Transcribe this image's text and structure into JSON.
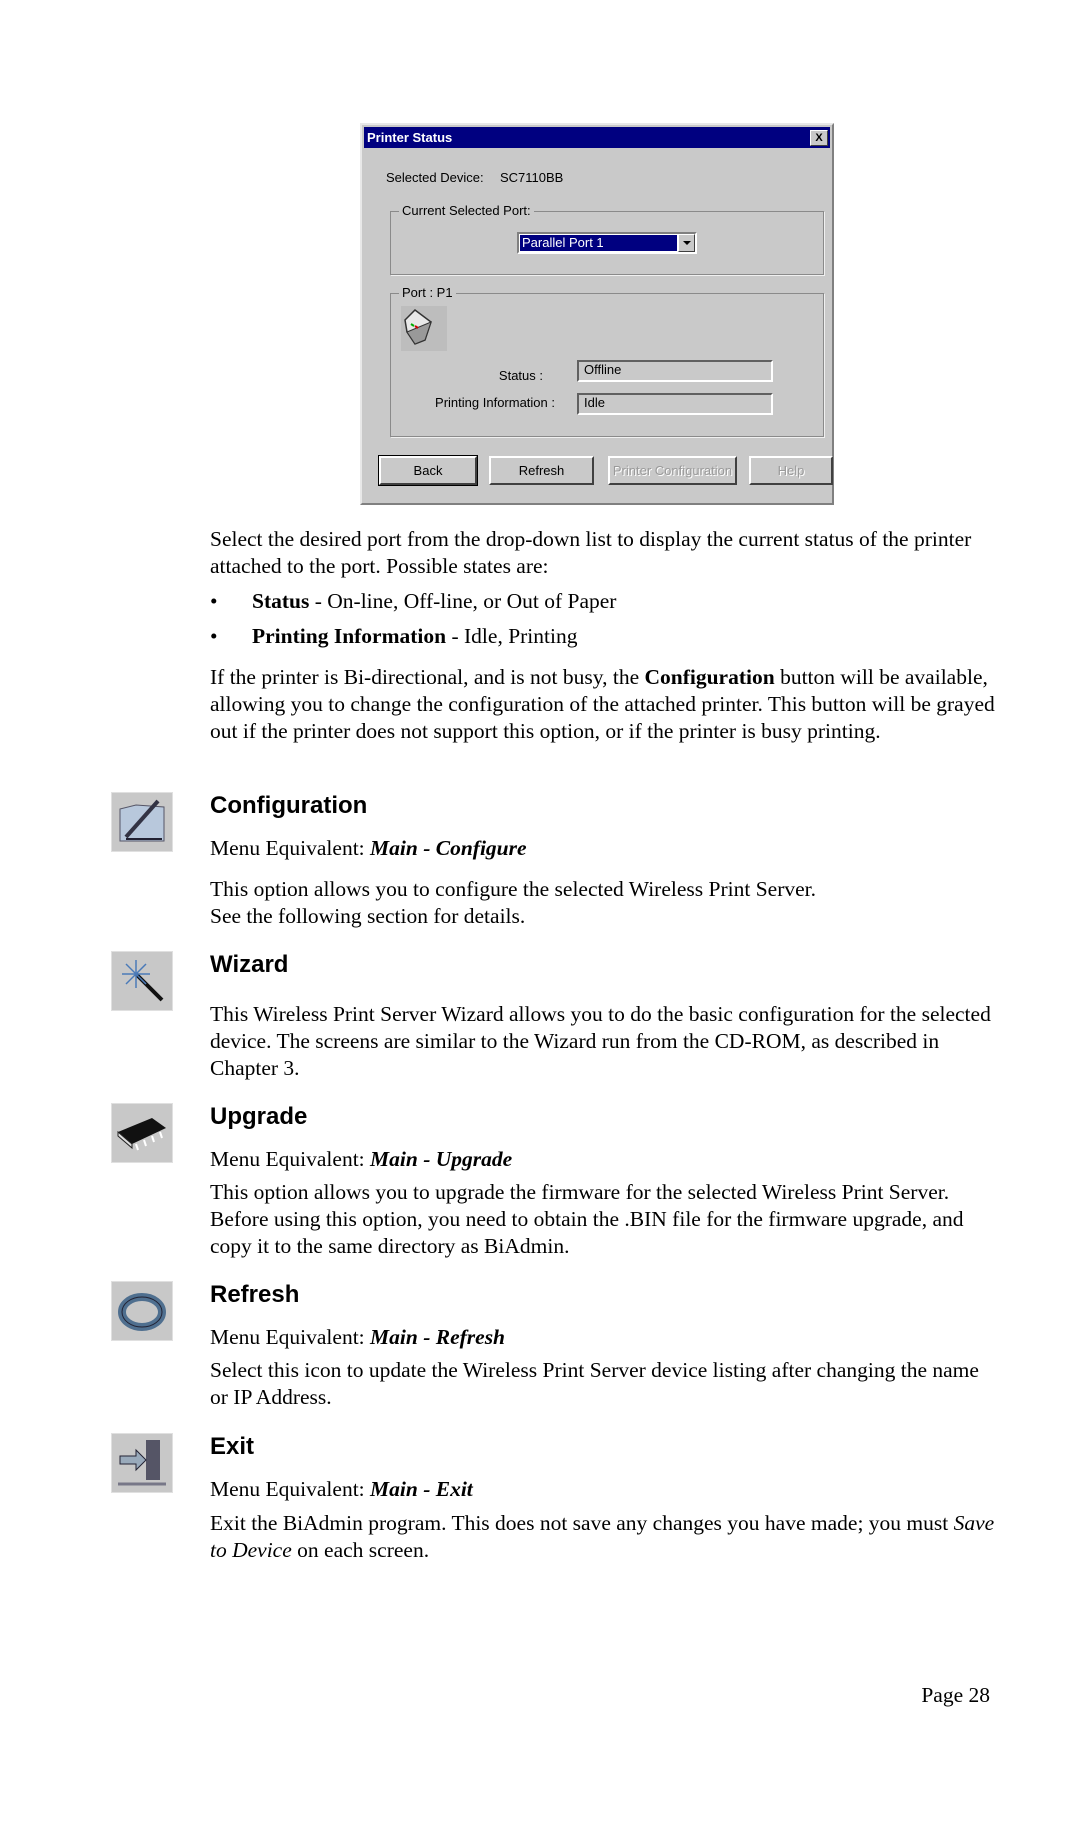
{
  "dialog": {
    "title": "Printer Status",
    "close_label": "X",
    "selected_device_label": "Selected Device:",
    "selected_device_value": "SC7110BB",
    "port_group_label": "Current Selected Port:",
    "port_dropdown_value": "Parallel Port 1",
    "port_info_group_label": "Port : P1",
    "status_label": "Status :",
    "status_value": "Offline",
    "printing_info_label": "Printing Information :",
    "printing_info_value": "Idle",
    "buttons": {
      "back": "Back",
      "refresh": "Refresh",
      "printer_configuration": "Printer Configuration",
      "help": "Help"
    }
  },
  "intro": {
    "para1": "Select the desired port from the drop-down list to display the current status of the printer attached to the port. Possible states are:",
    "bullets": [
      {
        "term": "Status",
        "text": " - On-line, Off-line, or Out of Paper"
      },
      {
        "term": "Printing Information",
        "text": " - Idle, Printing"
      }
    ],
    "para2_a": "If the printer is Bi-directional, and is not busy, the ",
    "para2_bold": "Configuration",
    "para2_b": " button will be available, allowing you to change the configuration of the attached printer. This button will be grayed out if the printer does not support this option, or if the printer is busy printing."
  },
  "sections": {
    "configuration": {
      "icon": "configure-pen-folder-icon",
      "title": "Configuration",
      "menu_prefix": "Menu Equivalent: ",
      "menu_path": "Main - Configure",
      "body_line1": "This option allows you to configure the selected Wireless Print Server.",
      "body_line2": "See the following section for details."
    },
    "wizard": {
      "icon": "magic-wand-icon",
      "title": "Wizard",
      "body": "This Wireless Print Server Wizard allows you to do the basic configuration for the selected device. The screens are similar to the Wizard run from the CD-ROM, as described in Chapter 3."
    },
    "upgrade": {
      "icon": "memory-chip-icon",
      "title": "Upgrade",
      "menu_prefix": "Menu Equivalent: ",
      "menu_path": "Main - Upgrade",
      "body": "This option allows you to upgrade the firmware for the selected Wireless Print Server. Before using this option, you need to obtain the .BIN file for the firmware upgrade, and copy it to the same directory as BiAdmin."
    },
    "refresh": {
      "icon": "refresh-arrows-icon",
      "title": "Refresh",
      "menu_prefix": "Menu Equivalent: ",
      "menu_path": "Main - Refresh",
      "body": "Select this icon to update the Wireless Print Server device listing after changing the name or IP Address."
    },
    "exit": {
      "icon": "exit-door-icon",
      "title": "Exit",
      "menu_prefix": "Menu Equivalent: ",
      "menu_path": "Main - Exit",
      "body_a": "Exit the BiAdmin program. This does not save any changes you have made; you must ",
      "body_italic": "Save to Device",
      "body_b": " on each screen."
    }
  },
  "footer": {
    "page": "Page 28"
  },
  "colors": {
    "titlebar": "#000080",
    "dialog_bg": "#c9c9c9"
  }
}
